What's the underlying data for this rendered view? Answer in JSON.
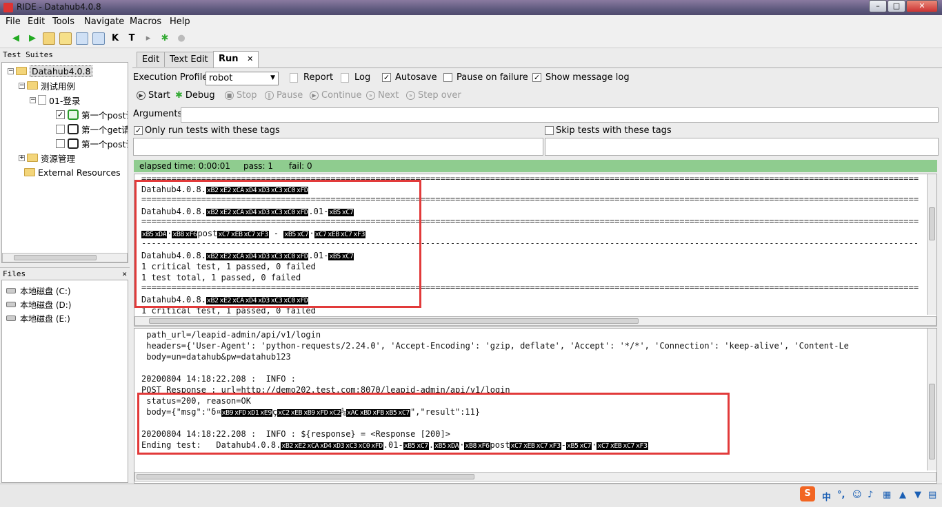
{
  "window": {
    "title": "RIDE - Datahub4.0.8"
  },
  "menu": [
    "File",
    "Edit",
    "Tools",
    "Navigate",
    "Macros",
    "Help"
  ],
  "left": {
    "test_suites_label": "Test Suites",
    "tree": {
      "root": "Datahub4.0.8",
      "folder1": "测试用例",
      "suite": "01-登录",
      "test1": "第一个post请",
      "test2": "第一个get请",
      "test3": "第一个post请",
      "folder2": "资源管理",
      "external": "External Resources"
    },
    "files_label": "Files",
    "files_close": "✕",
    "drives": [
      "本地磁盘 (C:)",
      "本地磁盘 (D:)",
      "本地磁盘 (E:)"
    ]
  },
  "tabs": {
    "edit": "Edit",
    "text_edit": "Text Edit",
    "run": "Run",
    "close": "✕"
  },
  "run": {
    "execution_profile_label": "Execution Profile:",
    "execution_profile_value": "robot",
    "report_label": "Report",
    "log_label": "Log",
    "autosave_label": "Autosave",
    "pause_on_failure_label": "Pause on failure",
    "show_message_log_label": "Show message log",
    "start_label": "Start",
    "debug_label": "Debug",
    "stop_label": "Stop",
    "pause_label": "Pause",
    "continue_label": "Continue",
    "next_label": "Next",
    "step_over_label": "Step over",
    "arguments_label": "Arguments:",
    "only_run_tags_label": "Only run tests with these tags",
    "skip_tags_label": "Skip tests with these tags",
    "status": "elapsed time: 0:00:01     pass: 1      fail: 0",
    "autosave_checked": true,
    "show_message_log_checked": true,
    "only_run_tags_checked": true
  },
  "output": {
    "suite_name": "Datahub4.0.8.",
    "suite_suffix": ".01-",
    "post_text": "post",
    "critical_line": "1 critical test, 1 passed, 0 failed",
    "total_line": "1 test total, 1 passed, 0 failed"
  },
  "log": {
    "l1": " path_url=/leapid-admin/api/v1/login",
    "l2": " headers={'User-Agent': 'python-requests/2.24.0', 'Accept-Encoding': 'gzip, deflate', 'Accept': '*/*', 'Connection': 'keep-alive', 'Content-Le",
    "l3": " body=un=datahub&pw=datahub123",
    "l4": "20200804 14:18:22.208 :  INFO :",
    "l5": "POST Response : url=http://demo202.test.com:8070/leapid-admin/api/v1/login",
    "l6": " status=200, reason=OK",
    "l7_prefix": " body={\"msg\":\"δ¤",
    "l7_suffix": "\",\"result\":11}",
    "l8": "20200804 14:18:22.208 :  INFO : ${response} = <Response [200]>",
    "l9_prefix": "Ending test:   Datahub4.0.8.",
    "l9_mid": ".01-",
    "l9_post": "post"
  },
  "tray": {
    "ime": "中",
    "punct": "°,"
  },
  "colors": {
    "status_green": "#8fcc8f",
    "highlight_red": "#e23a3a"
  }
}
